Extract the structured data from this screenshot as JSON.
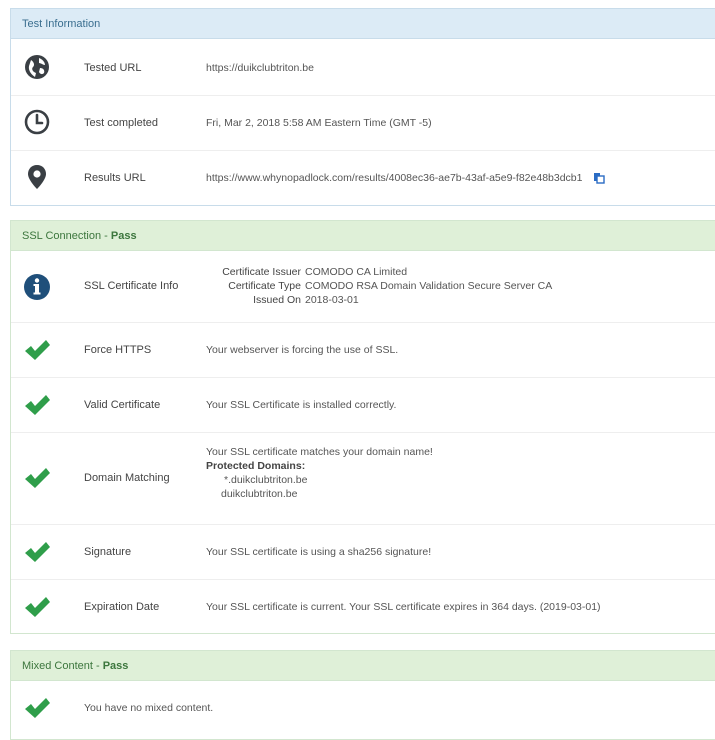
{
  "test_info": {
    "header": "Test Information",
    "rows": [
      {
        "label": "Tested URL",
        "value": "https://duikclubtriton.be",
        "icon": "globe-icon"
      },
      {
        "label": "Test completed",
        "value": "Fri, Mar 2, 2018 5:58 AM Eastern Time (GMT -5)",
        "icon": "clock-icon"
      },
      {
        "label": "Results URL",
        "value": "https://www.whynopadlock.com/results/4008ec36-ae7b-43af-a5e9-f82e48b3dcb1",
        "icon": "map-pin-icon"
      }
    ]
  },
  "ssl": {
    "header": "SSL Connection - ",
    "status": "Pass",
    "cert_info": {
      "label": "SSL Certificate Info",
      "issuer_key": "Certificate Issuer",
      "issuer_value": "COMODO CA Limited",
      "type_key": "Certificate Type",
      "type_value": "COMODO RSA Domain Validation Secure Server CA",
      "issued_key": "Issued On",
      "issued_value": "2018-03-01"
    },
    "force_https": {
      "label": "Force HTTPS",
      "value": "Your webserver is forcing the use of SSL."
    },
    "valid_cert": {
      "label": "Valid Certificate",
      "value": "Your SSL Certificate is installed correctly."
    },
    "domain_matching": {
      "label": "Domain Matching",
      "line1": "Your SSL certificate matches your domain name!",
      "protected_label": "Protected Domains:",
      "domains": [
        "*.duikclubtriton.be",
        "duikclubtriton.be"
      ]
    },
    "signature": {
      "label": "Signature",
      "value": "Your SSL certificate is using a sha256 signature!"
    },
    "expiration": {
      "label": "Expiration Date",
      "value": "Your SSL certificate is current. Your SSL certificate expires in 364 days. (2019-03-01)"
    }
  },
  "mixed": {
    "header": "Mixed Content - ",
    "status": "Pass",
    "message": "You have no mixed content."
  },
  "colors": {
    "check_green": "#2f9e4a",
    "icon_dark": "#3a3f44",
    "info_blue": "#1f4f7a",
    "copy_blue": "#2b6cc4"
  }
}
